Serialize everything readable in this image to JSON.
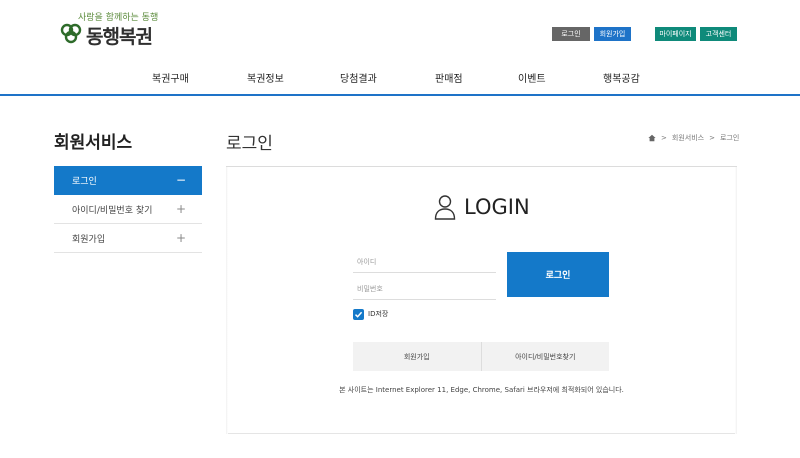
{
  "header": {
    "logo_tagline": "사랑을 함께하는 동행",
    "logo_name": "동행복권",
    "top_buttons": {
      "login": "로그인",
      "join": "회원가입",
      "mypage": "마이페이지",
      "cs": "고객센터"
    },
    "gnb": [
      "복권구매",
      "복권정보",
      "당첨결과",
      "판매점",
      "이벤트",
      "행복공감"
    ]
  },
  "sidebar": {
    "title": "회원서비스",
    "items": [
      {
        "label": "로그인",
        "sign": "−",
        "active": true
      },
      {
        "label": "아이디/비밀번호 찾기",
        "sign": "+"
      },
      {
        "label": "회원가입",
        "sign": "+"
      }
    ]
  },
  "content": {
    "page_title": "로그인",
    "breadcrumb": [
      "회원서비스",
      "로그인"
    ],
    "login_heading": "LOGIN",
    "id_placeholder": "아이디",
    "pw_placeholder": "비밀번호",
    "login_button": "로그인",
    "remember_label": "ID저장",
    "remember_checked": true,
    "sub_links": [
      "회원가입",
      "아이디/비밀번호찾기"
    ],
    "notice": "본 사이트는 Internet Explorer 11, Edge, Chrome, Safari 브라우저에 최적화되어 있습니다."
  },
  "colors": {
    "accent_blue": "#1479c9",
    "header_line": "#1e73c8",
    "teal": "#0f8a7a",
    "gray_button": "#666666"
  }
}
